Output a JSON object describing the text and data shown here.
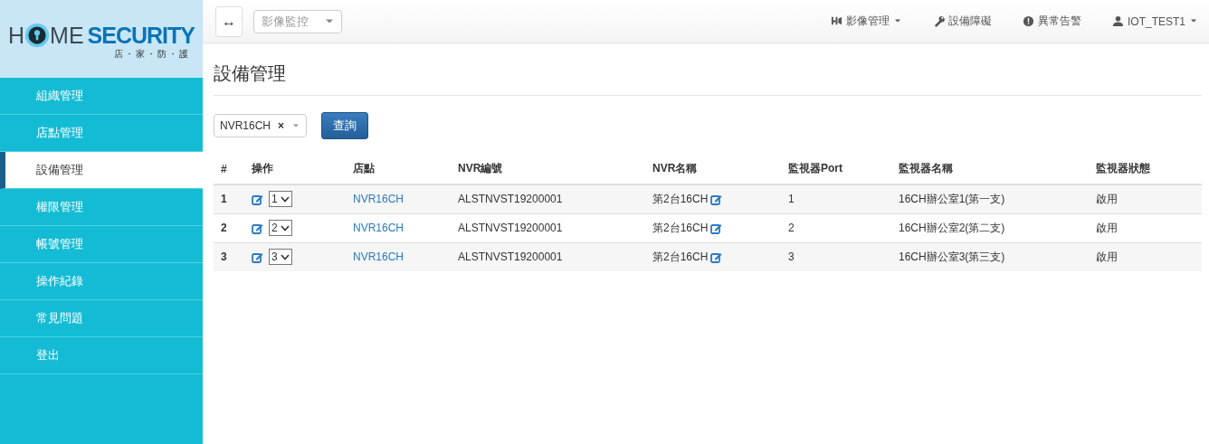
{
  "logo": {
    "left": "H",
    "right": "ME",
    "accent": "SECURITY",
    "tagline": "店・家・防・護"
  },
  "sidebar": {
    "items": [
      {
        "label": "組織管理",
        "selected": false
      },
      {
        "label": "店點管理",
        "selected": false
      },
      {
        "label": "設備管理",
        "selected": true
      },
      {
        "label": "權限管理",
        "selected": false
      },
      {
        "label": "帳號管理",
        "selected": false
      },
      {
        "label": "操作紀錄",
        "selected": false
      },
      {
        "label": "常見問題",
        "selected": false
      },
      {
        "label": "登出",
        "selected": false
      }
    ]
  },
  "topbar": {
    "toggle": "↔",
    "view_select": "影像監控",
    "nav": [
      {
        "kind": "video",
        "label": "影像管理",
        "dropdown": true
      },
      {
        "kind": "wrench",
        "label": "設備障礙",
        "dropdown": false
      },
      {
        "kind": "alert",
        "label": "異常告警",
        "dropdown": false
      },
      {
        "kind": "user",
        "label": "IOT_TEST1",
        "dropdown": true
      }
    ]
  },
  "page_title": "設備管理",
  "filter": {
    "value": "NVR16CH",
    "clear": "×",
    "button": "查詢"
  },
  "table": {
    "columns": [
      "#",
      "操作",
      "店點",
      "NVR編號",
      "NVR名稱",
      "監視器Port",
      "監視器名稱",
      "監視器狀態"
    ],
    "rows": [
      {
        "index": "1",
        "order": "1",
        "store": "NVR16CH",
        "nvr_id": "ALSTNVST19200001",
        "nvr_name": "第2台16CH",
        "port": "1",
        "camera_name": "16CH辦公室1(第一支)",
        "status": "啟用"
      },
      {
        "index": "2",
        "order": "2",
        "store": "NVR16CH",
        "nvr_id": "ALSTNVST19200001",
        "nvr_name": "第2台16CH",
        "port": "2",
        "camera_name": "16CH辦公室2(第二支)",
        "status": "啟用"
      },
      {
        "index": "3",
        "order": "3",
        "store": "NVR16CH",
        "nvr_id": "ALSTNVST19200001",
        "nvr_name": "第2台16CH",
        "port": "3",
        "camera_name": "16CH辦公室3(第三支)",
        "status": "啟用"
      }
    ]
  }
}
